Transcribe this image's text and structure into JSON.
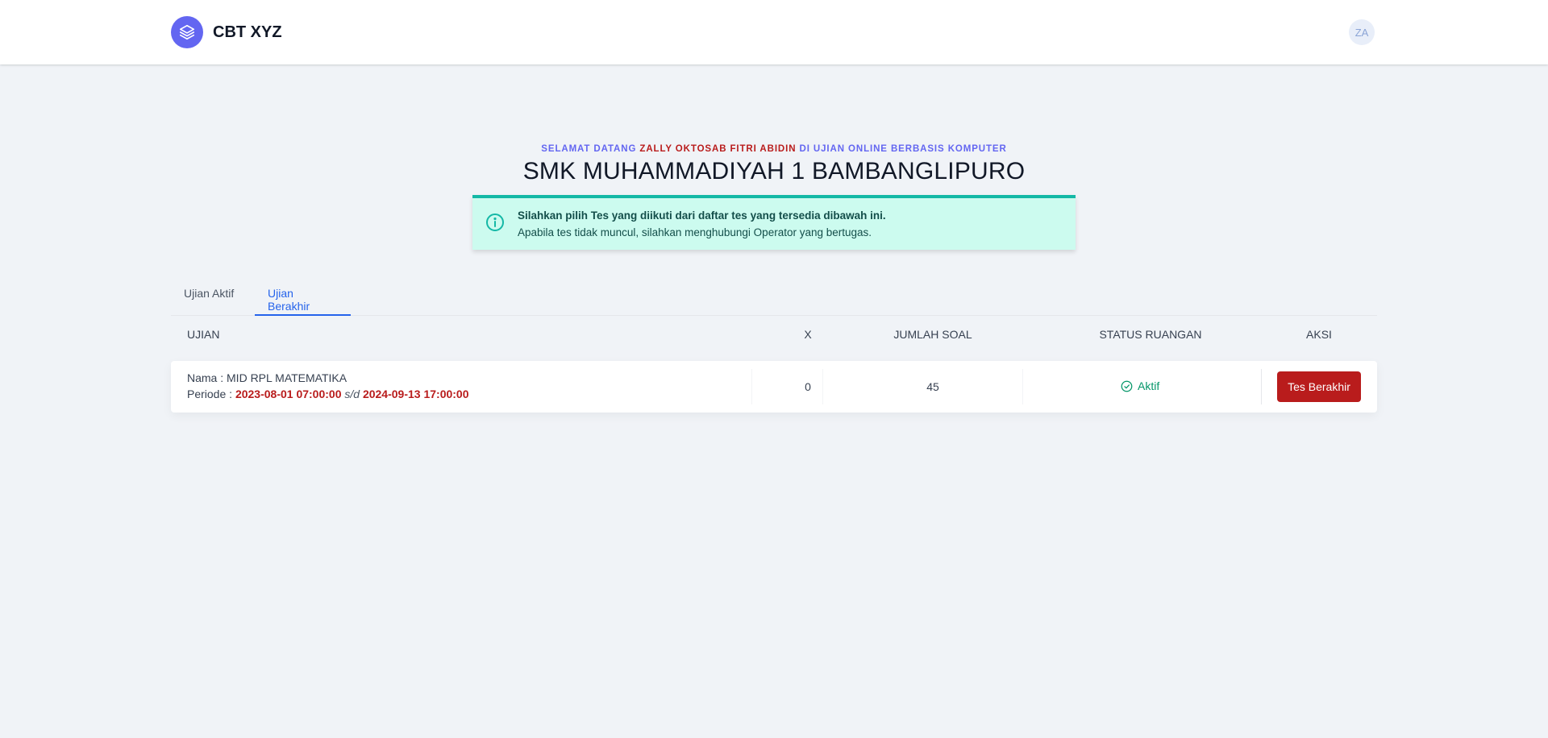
{
  "app": {
    "name": "CBT XYZ",
    "avatar_initials": "ZA",
    "accent_color": "#6366f1"
  },
  "welcome": {
    "prefix": "Selamat datang",
    "user": "Zally Oktosab Fitri Abidin",
    "suffix": "di Ujian Online Berbasis Komputer"
  },
  "school_name": "SMK MUHAMMADIYAH 1 BAMBANGLIPURO",
  "alert": {
    "icon": "info-icon",
    "title": "Silahkan pilih Tes yang diikuti dari daftar tes yang tersedia dibawah ini.",
    "body": "Apabila tes tidak muncul, silahkan menghubungi Operator yang bertugas."
  },
  "tabs": [
    {
      "label": "Ujian Aktif",
      "active": false
    },
    {
      "label": "Ujian Berakhir",
      "active": true
    }
  ],
  "table": {
    "headers": [
      "Ujian",
      "X",
      "Jumlah Soal",
      "Status Ruangan",
      "Aksi"
    ],
    "rows": [
      {
        "name_label": "Nama : MID RPL MATEMATIKA",
        "period_label": "Periode :",
        "start": "2023-08-01 07:00:00",
        "separator": "s/d",
        "end": "2024-09-13 17:00:00",
        "x": "0",
        "jumlah_soal": "45",
        "status": "Aktif",
        "action": "Tes Berakhir"
      }
    ]
  }
}
